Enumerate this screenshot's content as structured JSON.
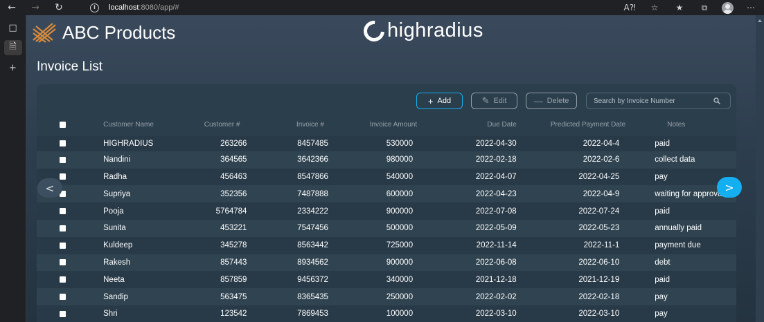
{
  "browser": {
    "url_host": "localhost",
    "url_rest": ":8080/app/#"
  },
  "app": {
    "brand": "ABC Products",
    "partner_logo": "highradius",
    "page_title": "Invoice List"
  },
  "toolbar": {
    "add_label": "Add",
    "edit_label": "Edit",
    "delete_label": "Delete",
    "search_placeholder": "Search by Invoice Number"
  },
  "table": {
    "columns": {
      "customer_name": "Customer Name",
      "customer_id": "Customer #",
      "invoice_id": "Invoice #",
      "invoice_amount": "Invoice Amount",
      "due_date": "Due Date",
      "predicted_date": "Predicted Payment Date",
      "notes": "Notes"
    },
    "rows": [
      {
        "name": "HIGHRADIUS",
        "cust": "263266",
        "inv": "8457485",
        "amt": "530000",
        "due": "2022-04-30",
        "pred": "2022-04-4",
        "notes": "paid"
      },
      {
        "name": "Nandini",
        "cust": "364565",
        "inv": "3642366",
        "amt": "980000",
        "due": "2022-02-18",
        "pred": "2022-02-6",
        "notes": "collect data"
      },
      {
        "name": "Radha",
        "cust": "456463",
        "inv": "8547866",
        "amt": "540000",
        "due": "2022-04-07",
        "pred": "2022-04-25",
        "notes": "pay"
      },
      {
        "name": "Supriya",
        "cust": "352356",
        "inv": "7487888",
        "amt": "600000",
        "due": "2022-04-23",
        "pred": "2022-04-9",
        "notes": "waiting for approval"
      },
      {
        "name": "Pooja",
        "cust": "5764784",
        "inv": "2334222",
        "amt": "900000",
        "due": "2022-07-08",
        "pred": "2022-07-24",
        "notes": "paid"
      },
      {
        "name": "Sunita",
        "cust": "453221",
        "inv": "7547456",
        "amt": "500000",
        "due": "2022-05-09",
        "pred": "2022-05-23",
        "notes": "annually paid"
      },
      {
        "name": "Kuldeep",
        "cust": "345278",
        "inv": "8563442",
        "amt": "725000",
        "due": "2022-11-14",
        "pred": "2022-11-1",
        "notes": "payment due"
      },
      {
        "name": "Rakesh",
        "cust": "857443",
        "inv": "8934562",
        "amt": "900000",
        "due": "2022-06-08",
        "pred": "2022-06-10",
        "notes": "debt"
      },
      {
        "name": "Neeta",
        "cust": "857859",
        "inv": "9456372",
        "amt": "340000",
        "due": "2021-12-18",
        "pred": "2021-12-19",
        "notes": "paid"
      },
      {
        "name": "Sandip",
        "cust": "563475",
        "inv": "8365435",
        "amt": "250000",
        "due": "2022-02-02",
        "pred": "2022-02-18",
        "notes": "pay"
      },
      {
        "name": "Shri",
        "cust": "123542",
        "inv": "7869453",
        "amt": "100000",
        "due": "2022-03-10",
        "pred": "2022-03-10",
        "notes": "pay"
      }
    ]
  },
  "pagination": {
    "prev_label": "<",
    "next_label": ">"
  },
  "colors": {
    "accent": "#14aff1",
    "panel": "#2b3e4c",
    "muted": "#97a1a9"
  }
}
